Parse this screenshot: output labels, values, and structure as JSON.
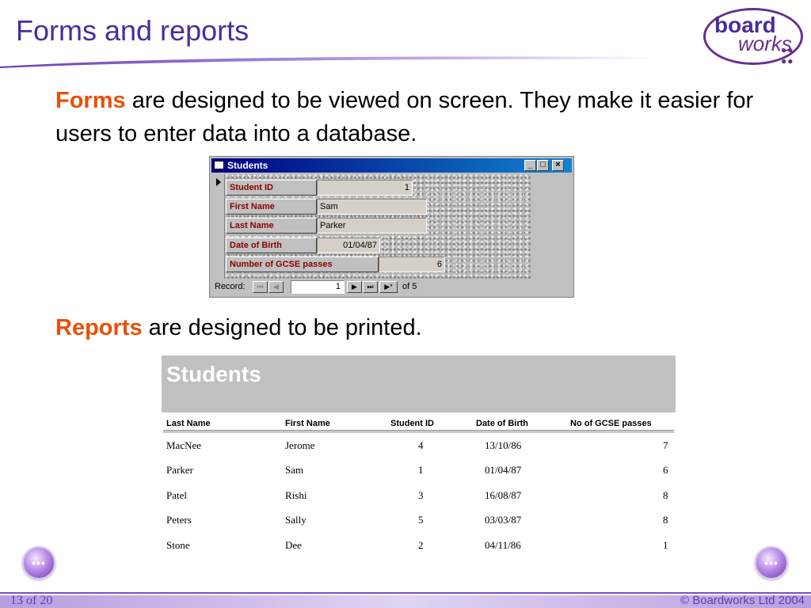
{
  "slide": {
    "title": "Forms and reports",
    "logo": {
      "line1": "board",
      "line2": "works"
    },
    "para1": {
      "keyword": "Forms",
      "text": " are designed to be viewed on screen. They make it easier for users to enter data into a database."
    },
    "para2": {
      "keyword": "Reports",
      "text": " are designed to be printed."
    }
  },
  "form_window": {
    "title": "Students",
    "fields": [
      {
        "label": "Student ID",
        "value": "1"
      },
      {
        "label": "First Name",
        "value": "Sam"
      },
      {
        "label": "Last Name",
        "value": "Parker"
      },
      {
        "label": "Date of Birth",
        "value": "01/04/87"
      },
      {
        "label": "Number of GCSE passes",
        "value": "6"
      }
    ],
    "nav": {
      "label": "Record:",
      "current": "1",
      "of_text": "of  5",
      "first_icon": "⏮",
      "prev_icon": "◀",
      "next_icon": "▶",
      "last_icon": "⏭",
      "new_icon": "▶*"
    },
    "buttons": {
      "minimize": "_",
      "maximize": "□",
      "close": "×"
    }
  },
  "report": {
    "title": "Students",
    "columns": [
      "Last Name",
      "First Name",
      "Student ID",
      "Date of Birth",
      "No of GCSE passes"
    ],
    "rows": [
      [
        "MacNee",
        "Jerome",
        "4",
        "13/10/86",
        "7"
      ],
      [
        "Parker",
        "Sam",
        "1",
        "01/04/87",
        "6"
      ],
      [
        "Patel",
        "Rishi",
        "3",
        "16/08/87",
        "8"
      ],
      [
        "Peters",
        "Sally",
        "5",
        "03/03/87",
        "8"
      ],
      [
        "Stone",
        "Dee",
        "2",
        "04/11/86",
        "1"
      ]
    ]
  },
  "footer": {
    "page": "13 of 20",
    "copyright": "© Boardworks Ltd 2004",
    "prev_icon": "•••",
    "next_icon": "•••"
  },
  "colors": {
    "title": "#4a2d9c",
    "keyword": "#e8500a",
    "field_label": "#8b0000",
    "accent": "#6a2e8a"
  }
}
